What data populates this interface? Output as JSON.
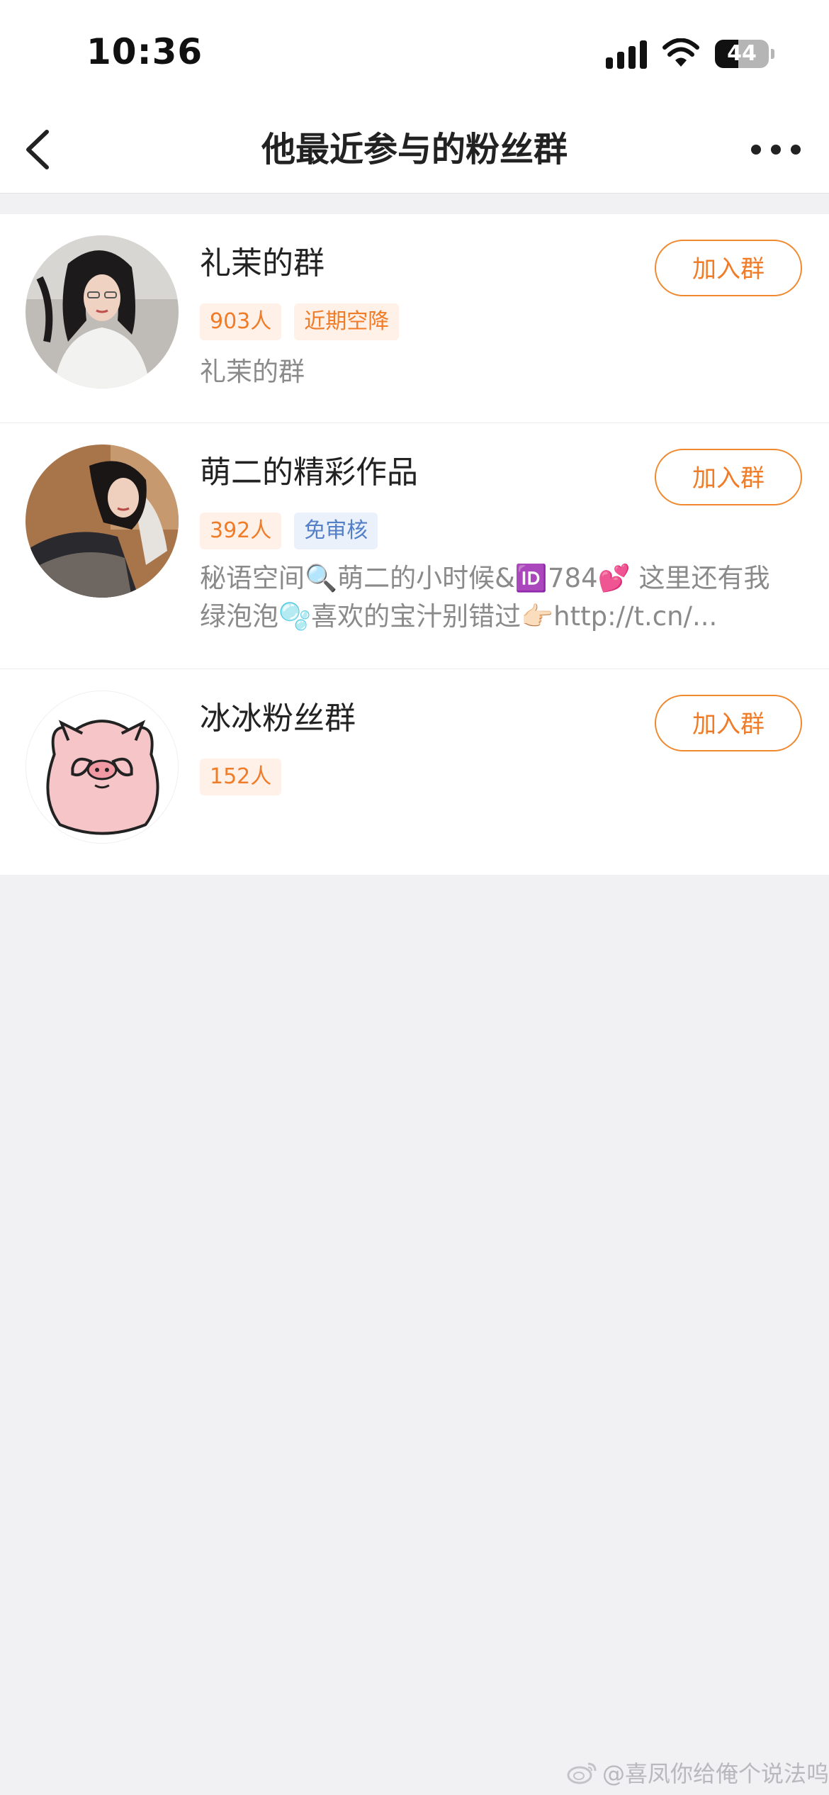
{
  "status_bar": {
    "time": "10:36",
    "battery": "44",
    "battery_level": 0.44
  },
  "header": {
    "title": "他最近参与的粉丝群",
    "back_icon": "chevron-left-icon",
    "more_icon": "more-dots-icon"
  },
  "groups": [
    {
      "name": "礼茉的群",
      "tags": [
        {
          "label": "903人",
          "color": "orange"
        },
        {
          "label": "近期空降",
          "color": "orange"
        }
      ],
      "desc": "礼茉的群",
      "join_label": "加入群",
      "avatar": "woman-in-white-shirt"
    },
    {
      "name": "萌二的精彩作品",
      "tags": [
        {
          "label": "392人",
          "color": "orange"
        },
        {
          "label": "免审核",
          "color": "blue"
        }
      ],
      "desc": "秘语空间🔍萌二的小时候&🆔784💕 这里还有我绿泡泡🫧喜欢的宝汁别错过👉🏻http://t.cn/...",
      "join_label": "加入群",
      "avatar": "woman-in-black-outfit"
    },
    {
      "name": "冰冰粉丝群",
      "tags": [
        {
          "label": "152人",
          "color": "orange"
        }
      ],
      "desc": "",
      "join_label": "加入群",
      "avatar": "pink-pig-cartoon"
    }
  ],
  "watermark": "@喜凤你给俺个说法呜",
  "colors": {
    "accent": "#f07c28",
    "tag_orange_bg": "#fff1e8",
    "tag_blue_bg": "#eaf1fb",
    "tag_blue_text": "#5380c6",
    "page_bg": "#f1f1f3"
  }
}
